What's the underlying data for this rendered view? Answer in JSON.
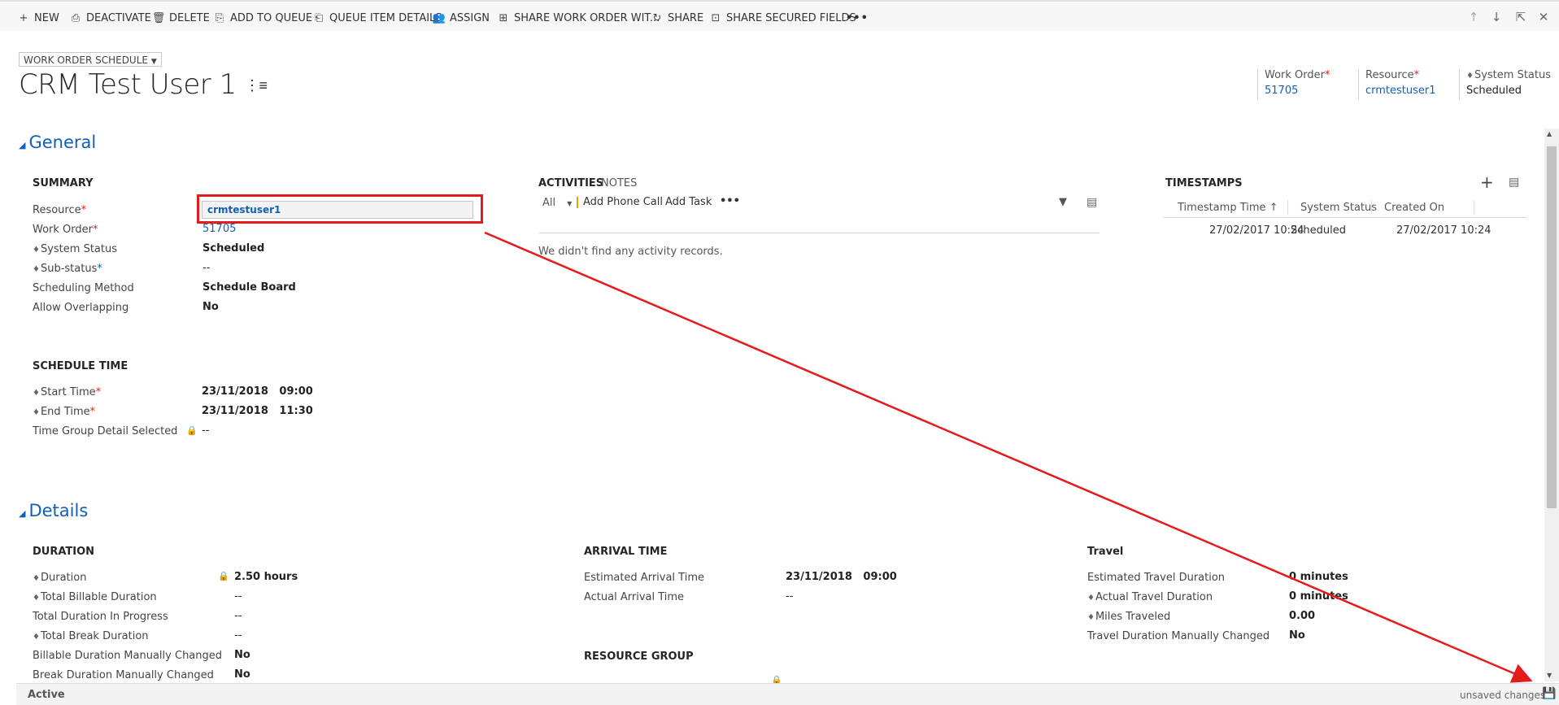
{
  "toolbar": {
    "items": [
      {
        "label": "NEW",
        "icon": "plus-icon"
      },
      {
        "label": "DEACTIVATE",
        "icon": "deactivate-icon"
      },
      {
        "label": "DELETE",
        "icon": "trash-icon"
      },
      {
        "label": "ADD TO QUEUE",
        "icon": "add-to-queue-icon"
      },
      {
        "label": "QUEUE ITEM DETAILS",
        "icon": "queue-details-icon"
      },
      {
        "label": "ASSIGN",
        "icon": "assign-icon"
      },
      {
        "label": "SHARE WORK ORDER WIT...",
        "icon": "share-link-icon"
      },
      {
        "label": "SHARE",
        "icon": "share-icon"
      },
      {
        "label": "SHARE SECURED FIELDS",
        "icon": "secured-fields-icon"
      }
    ],
    "more": "•••"
  },
  "header": {
    "form_selector": "WORK ORDER SCHEDULE",
    "title": "CRM Test User 1",
    "fields": {
      "work_order_label": "Work Order",
      "work_order_value": "51705",
      "resource_label": "Resource",
      "resource_value": "crmtestuser1",
      "system_status_label": "System Status",
      "system_status_value": "Scheduled"
    }
  },
  "general": {
    "title": "General",
    "summary": {
      "title": "SUMMARY",
      "resource_label": "Resource",
      "resource_value": "crmtestuser1",
      "work_order_label": "Work Order",
      "work_order_value": "51705",
      "system_status_label": "System Status",
      "system_status_value": "Scheduled",
      "sub_status_label": "Sub-status",
      "sub_status_value": "--",
      "scheduling_method_label": "Scheduling Method",
      "scheduling_method_value": "Schedule Board",
      "allow_overlapping_label": "Allow Overlapping",
      "allow_overlapping_value": "No"
    },
    "schedule_time": {
      "title": "SCHEDULE TIME",
      "start_label": "Start Time",
      "start_value": "23/11/2018   09:00",
      "end_label": "End Time",
      "end_value": "23/11/2018   11:30",
      "group_label": "Time Group Detail Selected",
      "group_value": "--"
    },
    "activities": {
      "tab_activities": "ACTIVITIES",
      "tab_notes": "NOTES",
      "filter_all": "All",
      "add_phone_call": "Add Phone Call",
      "add_task": "Add Task",
      "more": "•••",
      "empty_message": "We didn't find any activity records."
    },
    "timestamps": {
      "title": "TIMESTAMPS",
      "columns": [
        "Timestamp Time",
        "System Status",
        "Created On"
      ],
      "rows": [
        {
          "time": "27/02/2017 10:24",
          "status": "Scheduled",
          "created": "27/02/2017 10:24"
        }
      ]
    }
  },
  "details": {
    "title": "Details",
    "duration": {
      "title": "DURATION",
      "duration_label": "Duration",
      "duration_value": "2.50 hours",
      "total_billable_label": "Total Billable Duration",
      "total_billable_value": "--",
      "in_progress_label": "Total Duration In Progress",
      "in_progress_value": "--",
      "break_label": "Total Break Duration",
      "break_value": "--",
      "billable_changed_label": "Billable Duration Manually Changed",
      "billable_changed_value": "No",
      "break_changed_label": "Break Duration Manually Changed",
      "break_changed_value": "No"
    },
    "arrival": {
      "title": "ARRIVAL TIME",
      "estimated_label": "Estimated Arrival Time",
      "estimated_value": "23/11/2018   09:00",
      "actual_label": "Actual Arrival Time",
      "actual_value": "--"
    },
    "resource_group": {
      "title": "RESOURCE GROUP"
    },
    "travel": {
      "title": "Travel",
      "est_travel_label": "Estimated Travel Duration",
      "est_travel_value": "0 minutes",
      "actual_travel_label": "Actual Travel Duration",
      "actual_travel_value": "0 minutes",
      "miles_label": "Miles Traveled",
      "miles_value": "0.00",
      "manual_label": "Travel Duration Manually Changed",
      "manual_value": "No"
    }
  },
  "footer": {
    "status": "Active",
    "unsaved": "unsaved changes"
  },
  "colors": {
    "accent": "#1160b7",
    "required": "#e0201b",
    "annotation": "#e31b1b"
  }
}
